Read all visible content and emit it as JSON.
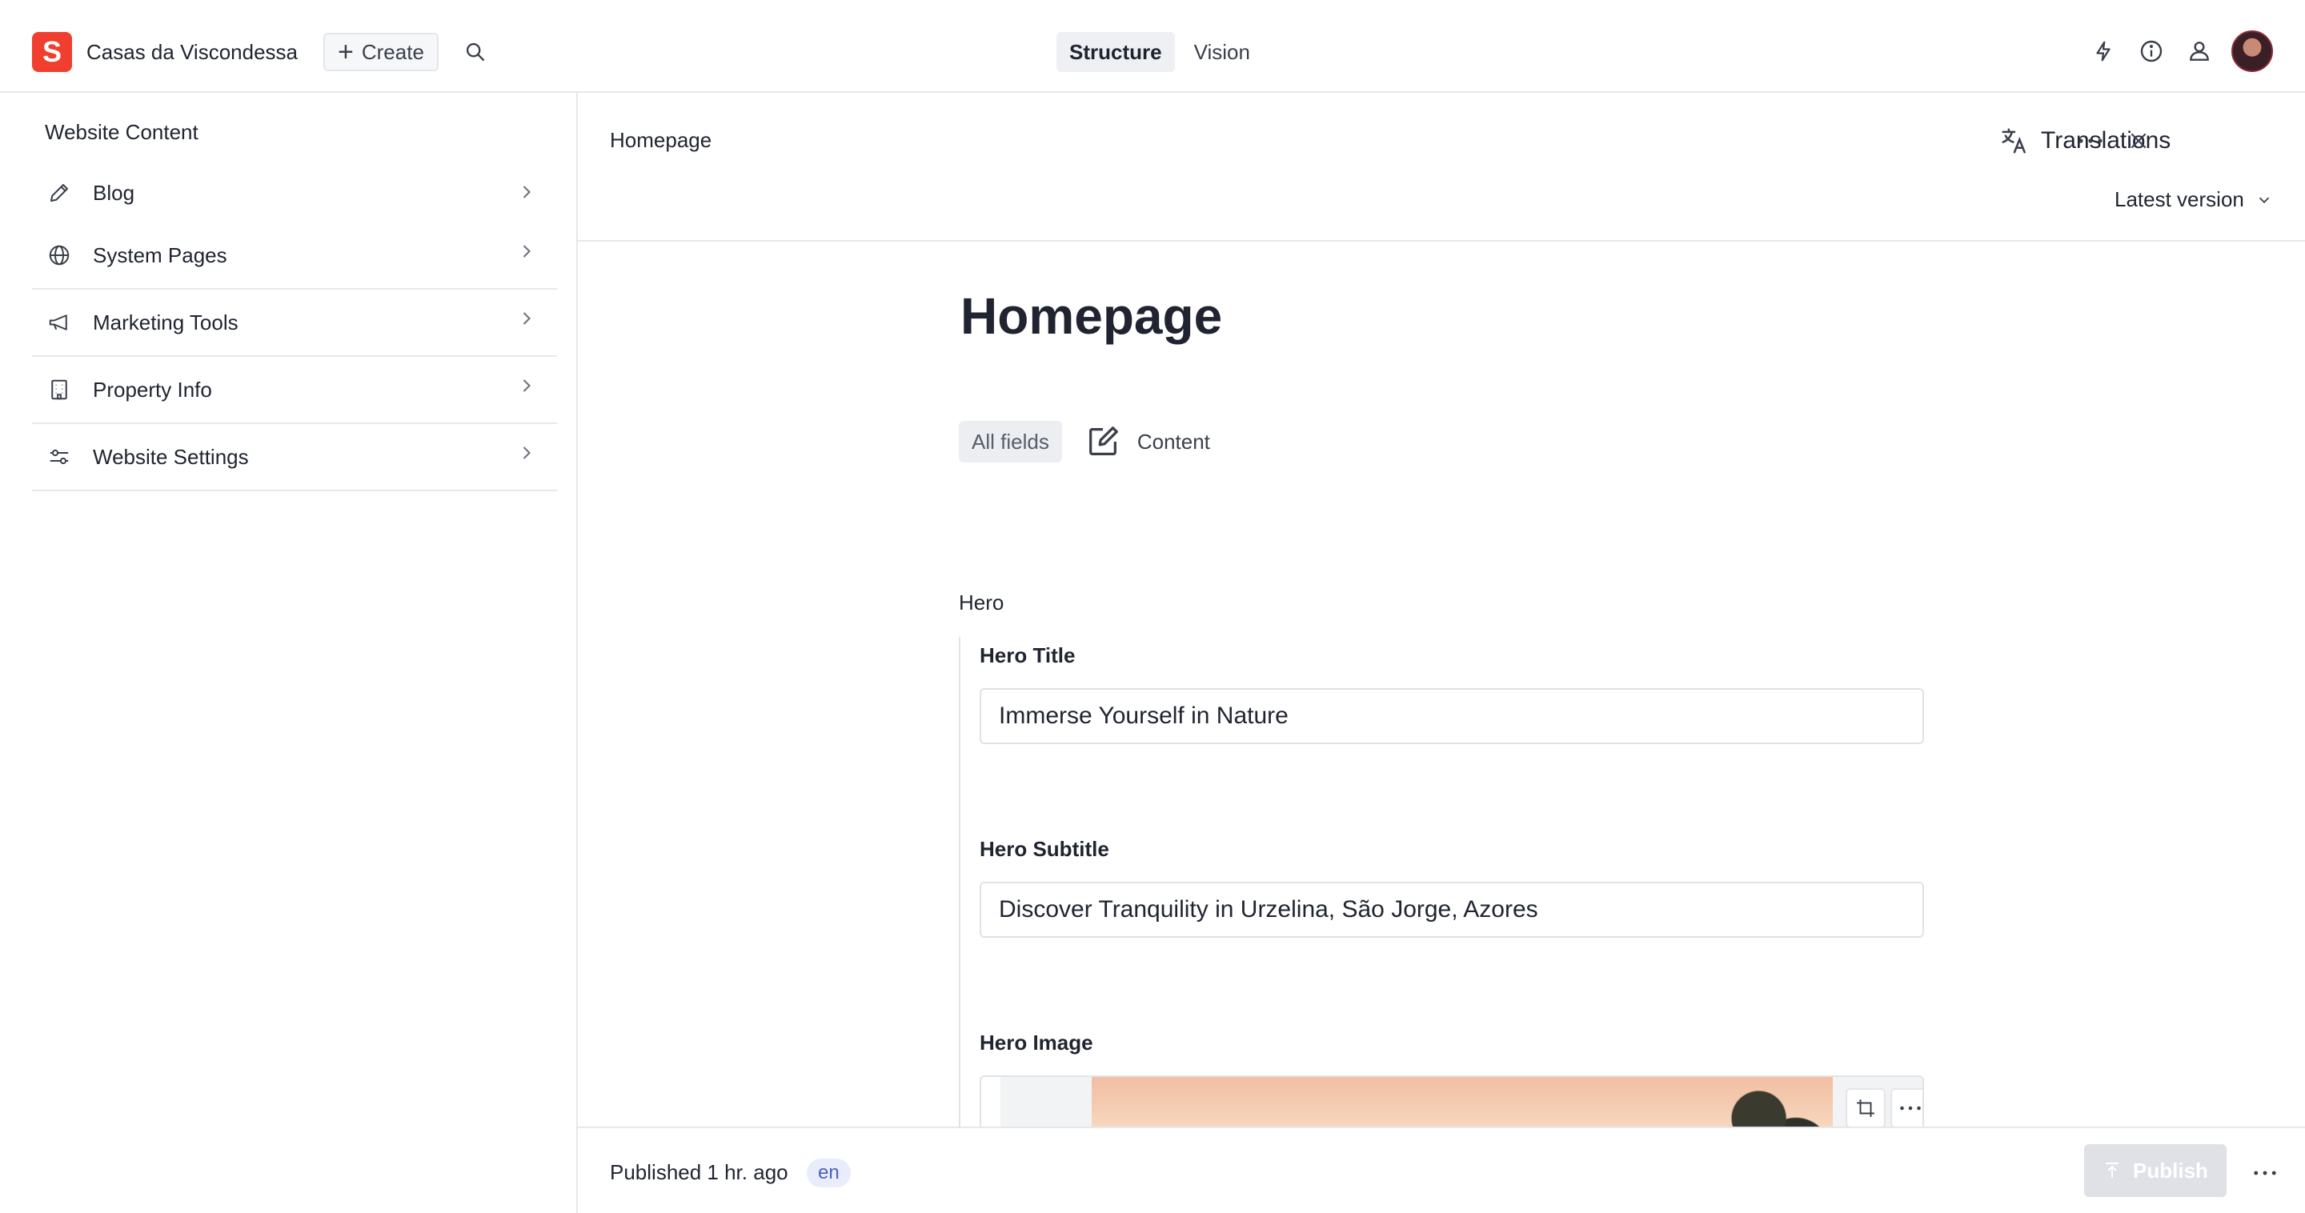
{
  "topbar": {
    "logo_letter": "S",
    "project_name": "Casas da Viscondessa",
    "create_label": "Create",
    "tools": [
      {
        "label": "Structure",
        "active": true
      },
      {
        "label": "Vision",
        "active": false
      }
    ],
    "icons": [
      "bolt-icon",
      "info-icon",
      "users-icon",
      "avatar"
    ]
  },
  "sidebar": {
    "title": "Website Content",
    "items": [
      {
        "label": "Blog",
        "icon": "pencil-icon"
      },
      {
        "label": "System Pages",
        "icon": "globe-icon"
      },
      {
        "label": "Marketing Tools",
        "icon": "megaphone-icon"
      },
      {
        "label": "Property Info",
        "icon": "building-icon"
      },
      {
        "label": "Website Settings",
        "icon": "sliders-icon"
      }
    ]
  },
  "document": {
    "breadcrumb": "Homepage",
    "translations_label": "Translations",
    "version_label": "Latest version",
    "title": "Homepage",
    "field_tabs": {
      "all_fields": "All fields",
      "content": "Content"
    },
    "group_label": "Hero",
    "fields": {
      "hero_title": {
        "label": "Hero Title",
        "value": "Immerse Yourself in Nature"
      },
      "hero_subtitle": {
        "label": "Hero Subtitle",
        "value": "Discover Tranquility in Urzelina, São Jorge, Azores"
      },
      "hero_image": {
        "label": "Hero Image"
      }
    }
  },
  "footer": {
    "status": "Published 1 hr. ago",
    "language": "en",
    "publish_label": "Publish"
  },
  "colors": {
    "brand": "#f03e2f",
    "badge_bg": "#e9edfb",
    "badge_text": "#4a5fc1",
    "publish_disabled": "#dfe1e6"
  }
}
